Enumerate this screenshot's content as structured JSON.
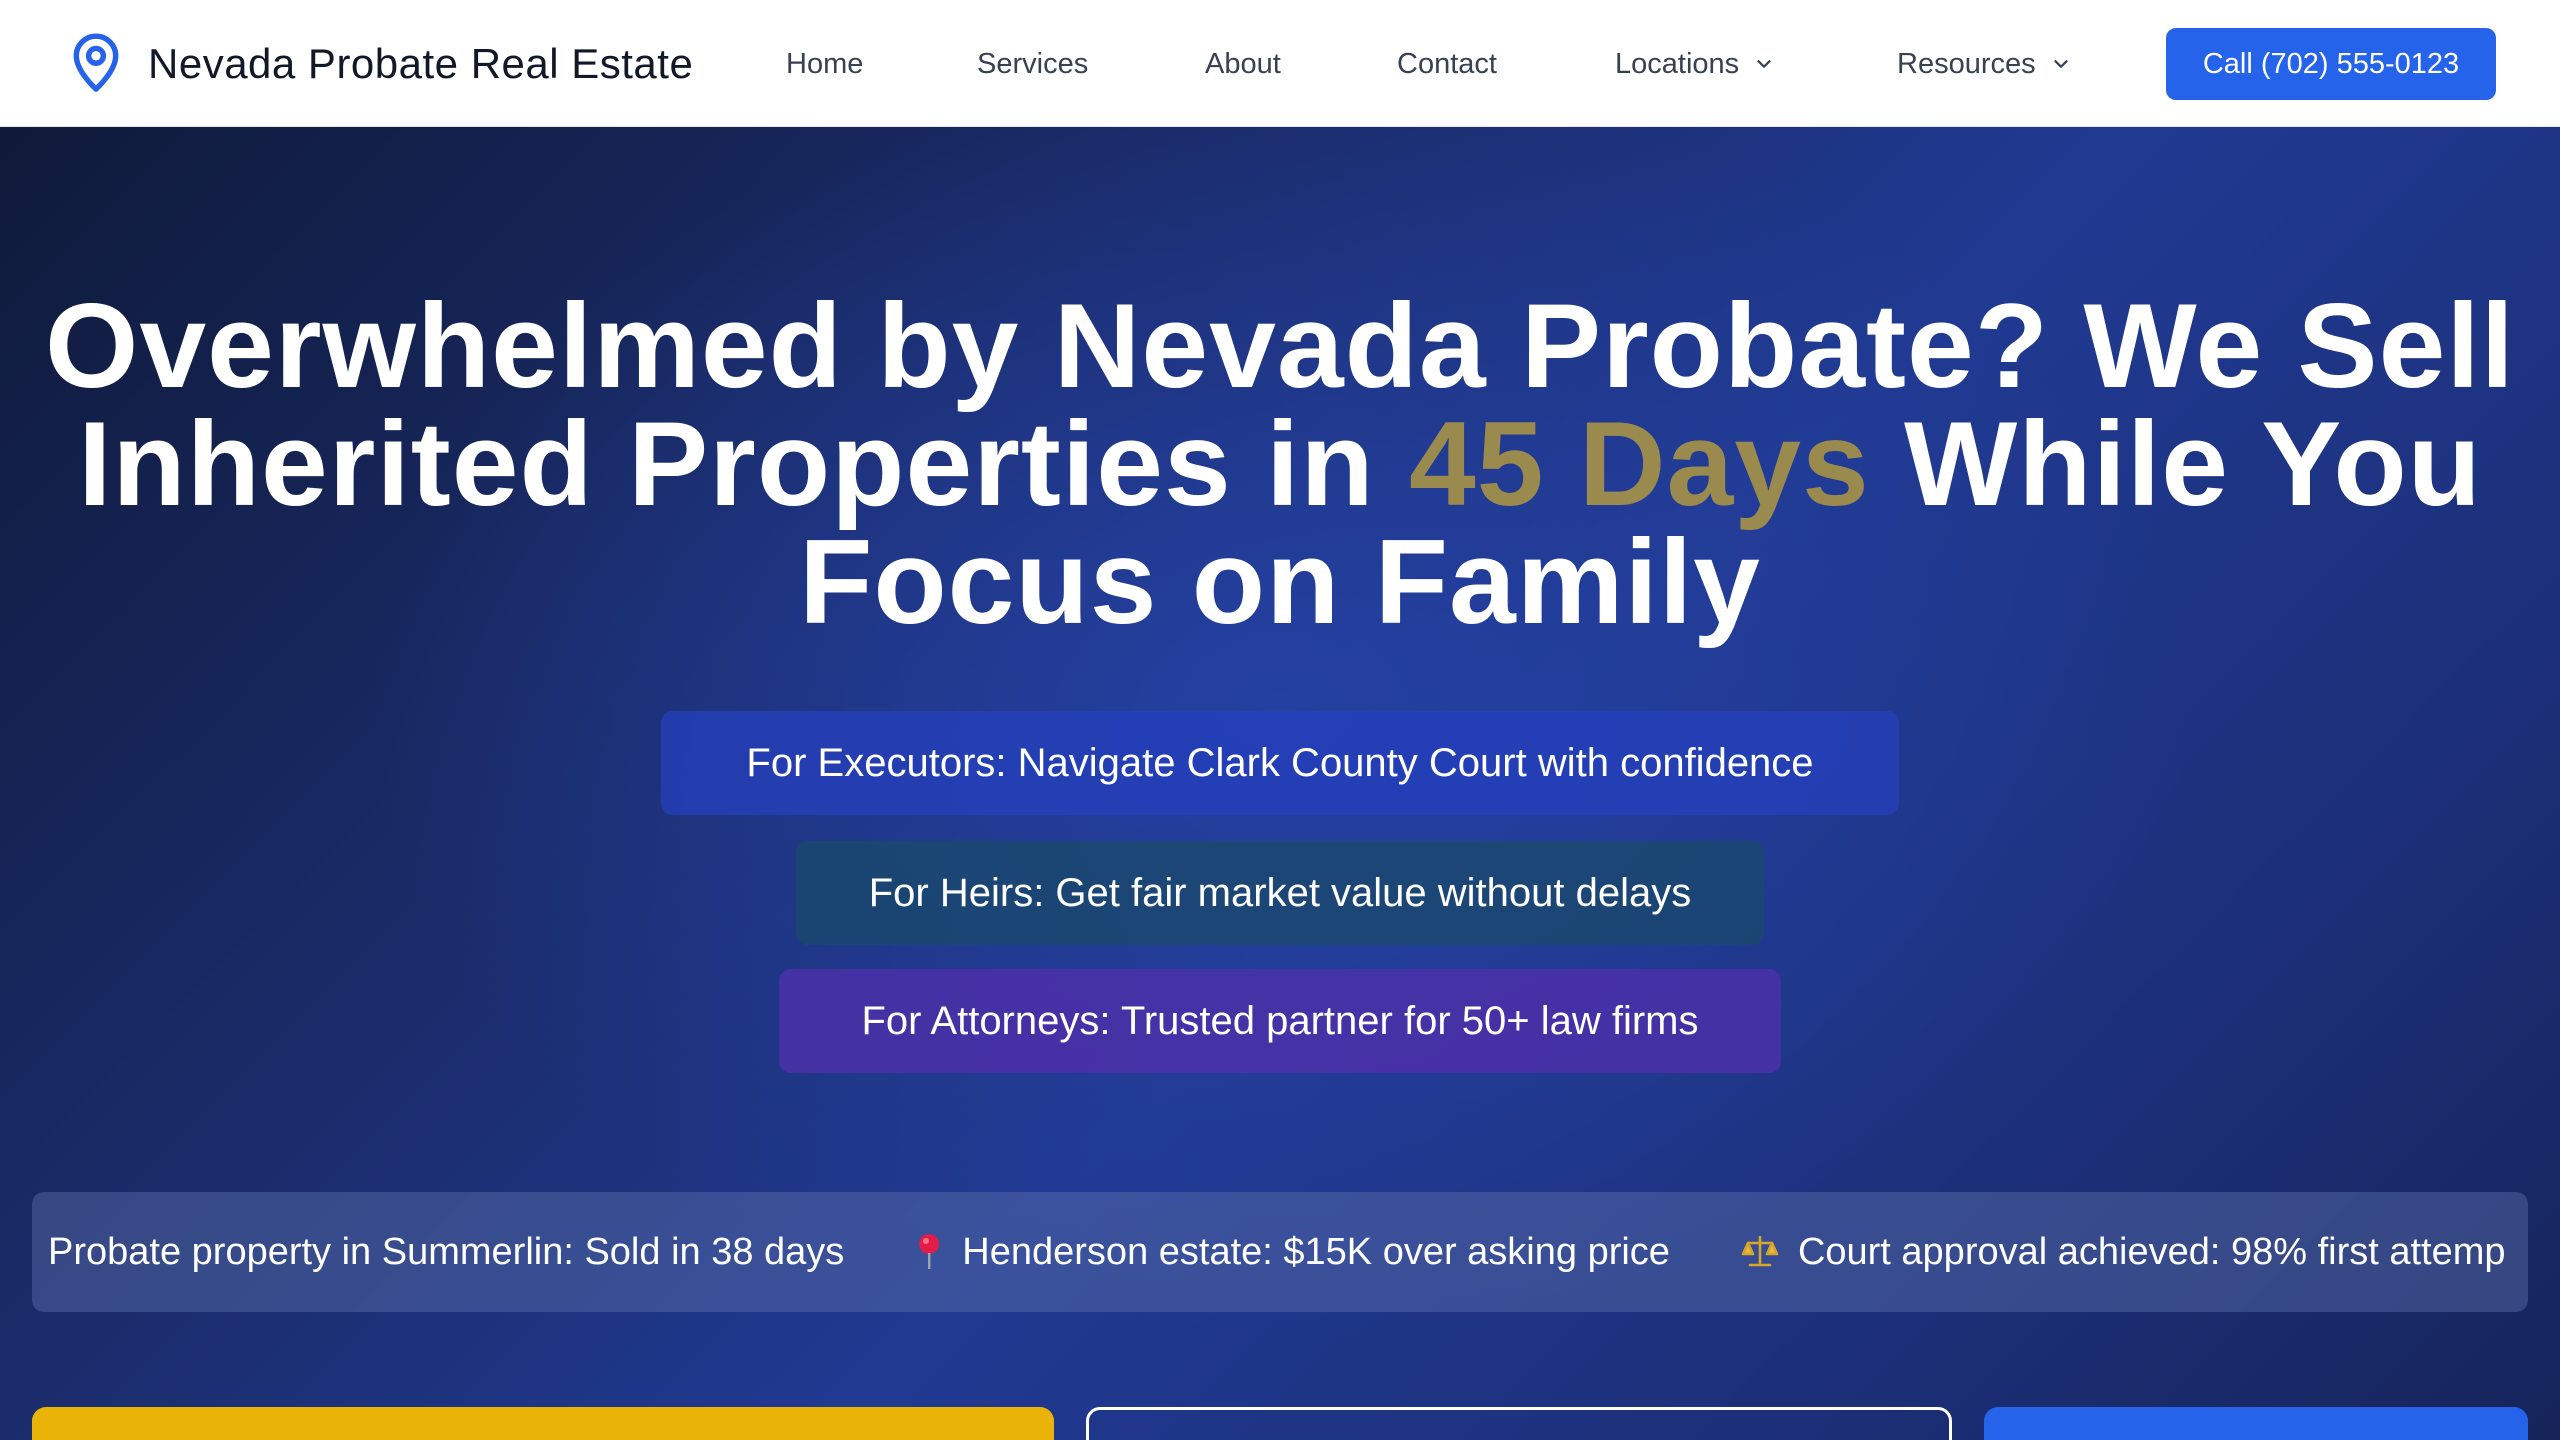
{
  "brand": {
    "name": "Nevada Probate Real Estate",
    "icon": "map-pin-icon"
  },
  "nav": {
    "items": [
      {
        "label": "Home"
      },
      {
        "label": "Services"
      },
      {
        "label": "About"
      },
      {
        "label": "Contact"
      },
      {
        "label": "Locations",
        "dropdown": true
      },
      {
        "label": "Resources",
        "dropdown": true
      }
    ],
    "cta_label": "Call (702) 555-0123"
  },
  "hero": {
    "headline_before": "Overwhelmed by Nevada Probate? We Sell Inherited Properties in ",
    "headline_accent": "45 Days",
    "headline_after": " While You Focus on Family",
    "audiences": [
      {
        "label": "For Executors: Navigate Clark County Court with confidence"
      },
      {
        "label": "For Heirs: Get fair market value without delays"
      },
      {
        "label": "For Attorneys: Trusted partner for 50+ law firms"
      }
    ],
    "ticker": [
      {
        "text": "Probate property in Summerlin: Sold in 38 days",
        "icon": ""
      },
      {
        "text": "Henderson estate: $15K over asking price",
        "icon": "pushpin-icon"
      },
      {
        "text": "Court approval achieved: 98% first attemp",
        "icon": "scales-icon"
      }
    ]
  },
  "colors": {
    "accent": "#9a8a4e",
    "cta_blue": "#2563eb",
    "cta_yellow": "#eab308"
  }
}
